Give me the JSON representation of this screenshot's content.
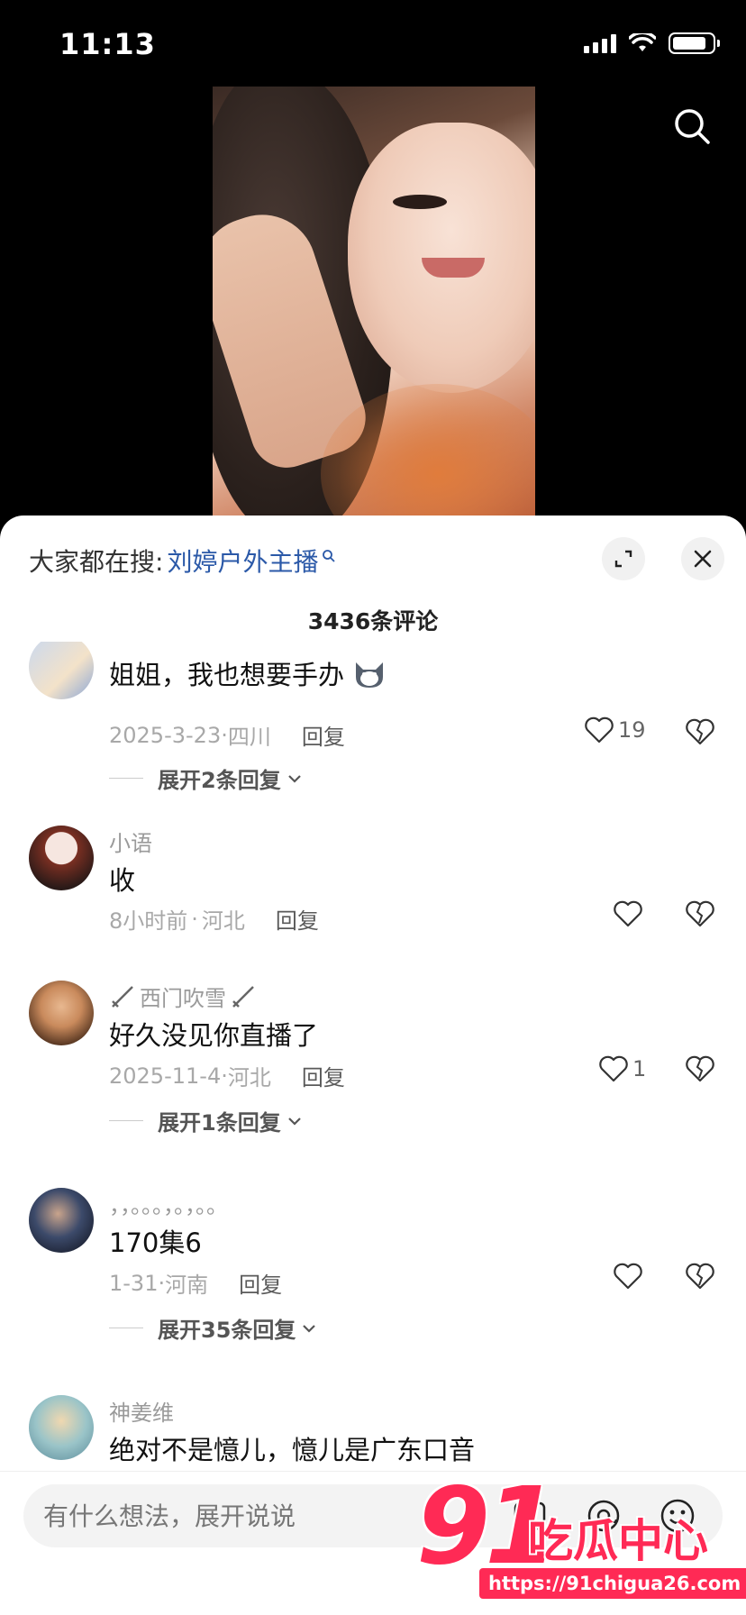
{
  "status_bar": {
    "time": "11:13"
  },
  "sheet": {
    "trending_label": "大家都在搜:",
    "trending_keyword": "刘婷户外主播",
    "comment_count": "3436条评论"
  },
  "comments": [
    {
      "username": "",
      "text": "姐姐，我也想要手办",
      "date": "2025-3-23",
      "location": "四川",
      "reply_label": "回复",
      "likes": "19",
      "expand": "展开2条回复"
    },
    {
      "username": "小语",
      "text": "收",
      "date": "8小时前",
      "location": "河北",
      "reply_label": "回复",
      "likes": ""
    },
    {
      "username": "西门吹雪",
      "text": "好久没见你直播了",
      "date": "2025-11-4",
      "location": "河北",
      "reply_label": "回复",
      "likes": "1",
      "expand": "展开1条回复"
    },
    {
      "username": "，，。。。，。，。。",
      "text": "170集6",
      "date": "1-31",
      "location": "河南",
      "reply_label": "回复",
      "likes": "",
      "expand": "展开35条回复"
    },
    {
      "username": "神姜维",
      "text": "绝对不是憶儿，憶儿是广东口音"
    }
  ],
  "input": {
    "placeholder": "有什么想法，展开说说"
  },
  "watermark": {
    "number": "91",
    "text": "吃瓜中心",
    "url": "https://91chigua26.com"
  },
  "icons": {
    "search": "search-icon",
    "expand": "expand-icon",
    "close": "close-icon",
    "like": "heart-icon",
    "dislike": "broken-heart-icon",
    "at": "at-icon",
    "emoji": "emoji-icon"
  }
}
